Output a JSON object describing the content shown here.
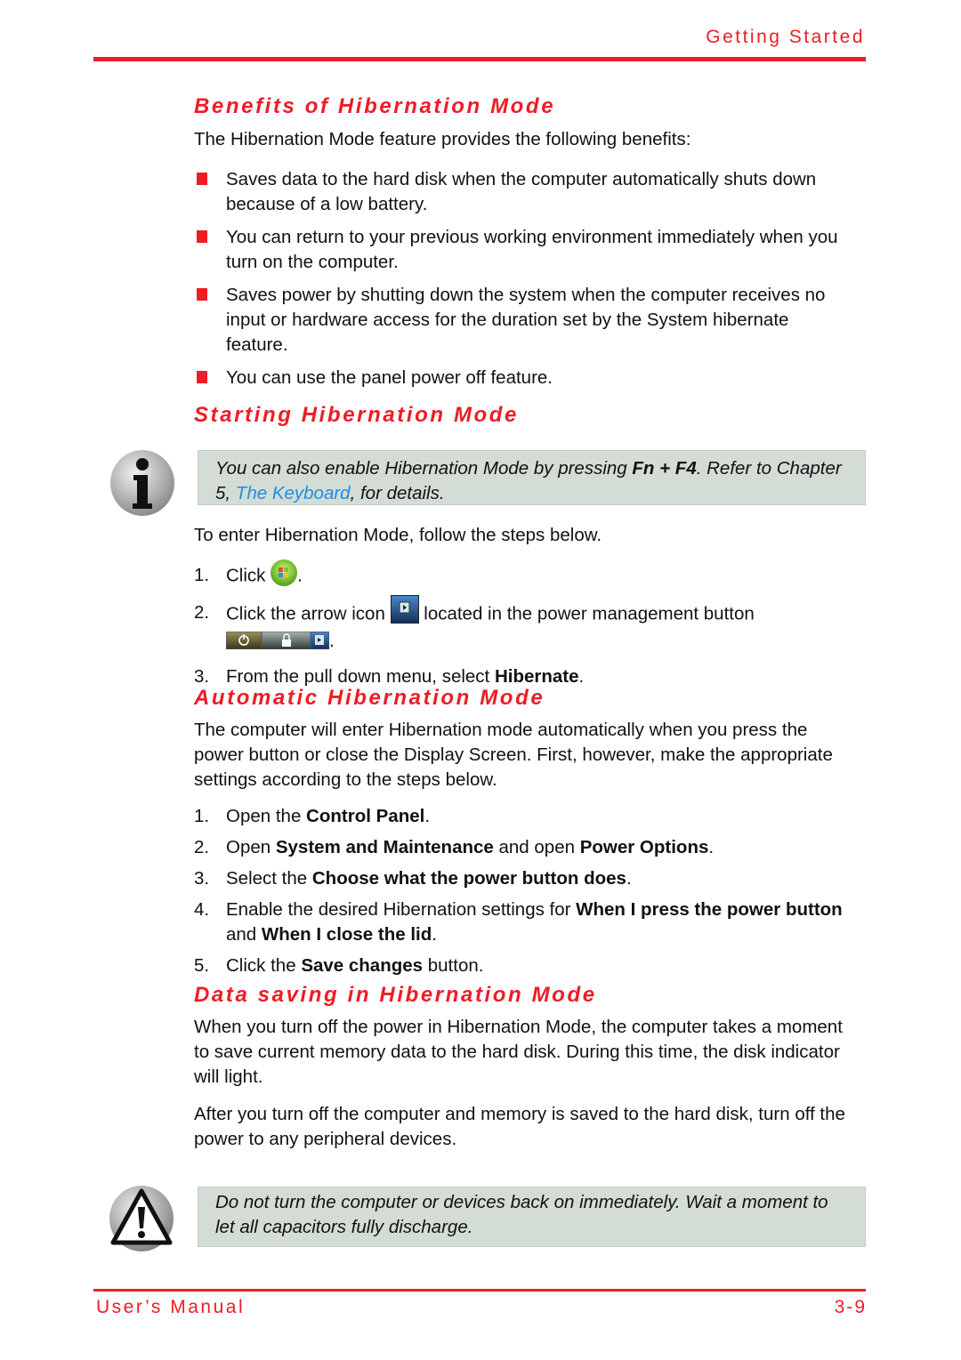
{
  "header": {
    "chapter_title": "Getting Started"
  },
  "sections": {
    "benefits": {
      "heading": "Benefits of Hibernation Mode",
      "intro": "The Hibernation Mode feature provides the following benefits:",
      "bullets": [
        "Saves data to the hard disk when the computer automatically shuts down because of a low battery.",
        "You can return to your previous working environment immediately when you turn on the computer.",
        "Saves power by shutting down the system when the computer receives no input or hardware access for the duration set by the System hibernate feature.",
        "You can use the panel power off feature."
      ]
    },
    "starting": {
      "heading": "Starting Hibernation Mode",
      "note": {
        "icon": "info-icon",
        "text_before": "You can also enable Hibernation Mode by pressing ",
        "key_combo": "Fn + F4",
        "text_middle": ". Refer to Chapter 5, ",
        "link_text": "The Keyboard",
        "text_after": ", for details."
      },
      "intro": "To enter Hibernation Mode, follow the steps below.",
      "steps": [
        {
          "num": "1.",
          "before": "Click ",
          "icon": "windows-start-orb-icon",
          "after": "."
        },
        {
          "num": "2.",
          "before": "Click the arrow icon ",
          "icon": "arrow-button-icon",
          "after": " located in the power management button",
          "icon2": "power-management-button-icon",
          "after2": "."
        },
        {
          "num": "3.",
          "before": "From the pull down menu, select ",
          "bold": "Hibernate",
          "after": "."
        }
      ]
    },
    "automatic": {
      "heading": "Automatic Hibernation Mode",
      "intro": "The computer will enter Hibernation mode automatically when you press the power button or close the Display Screen. First, however, make the appropriate settings according to the steps below.",
      "steps": [
        {
          "num": "1.",
          "t1": "Open the ",
          "b1": "Control Panel",
          "t2": ".",
          "b2": "",
          "t3": ""
        },
        {
          "num": "2.",
          "t1": "Open ",
          "b1": "System and Maintenance",
          "t2": " and open ",
          "b2": "Power Options",
          "t3": "."
        },
        {
          "num": "3.",
          "t1": "Select the ",
          "b1": "Choose what the power button does",
          "t2": ".",
          "b2": "",
          "t3": ""
        },
        {
          "num": "4.",
          "t1": "Enable the desired Hibernation settings for ",
          "b1": "When I press the power button",
          "t2": " and ",
          "b2": "When I close the lid",
          "t3": "."
        },
        {
          "num": "5.",
          "t1": "Click the ",
          "b1": "Save changes",
          "t2": " button.",
          "b2": "",
          "t3": ""
        }
      ]
    },
    "data_saving": {
      "heading": "Data saving in Hibernation Mode",
      "paragraphs": [
        "When you turn off the power in Hibernation Mode, the computer takes a moment to save current memory data to the hard disk. During this time, the disk indicator will light.",
        "After you turn off the computer and memory is saved to the hard disk, turn off the power to any peripheral devices."
      ],
      "caution": {
        "icon": "warning-icon",
        "text": "Do not turn the computer or devices back on immediately. Wait a moment to let all capacitors fully discharge."
      }
    }
  },
  "footer": {
    "manual_title": "User’s Manual",
    "page_number": "3-9"
  },
  "colors": {
    "accent": "#ee1c25",
    "note_bg": "#d4dcd6",
    "link": "#1f8ee0"
  }
}
